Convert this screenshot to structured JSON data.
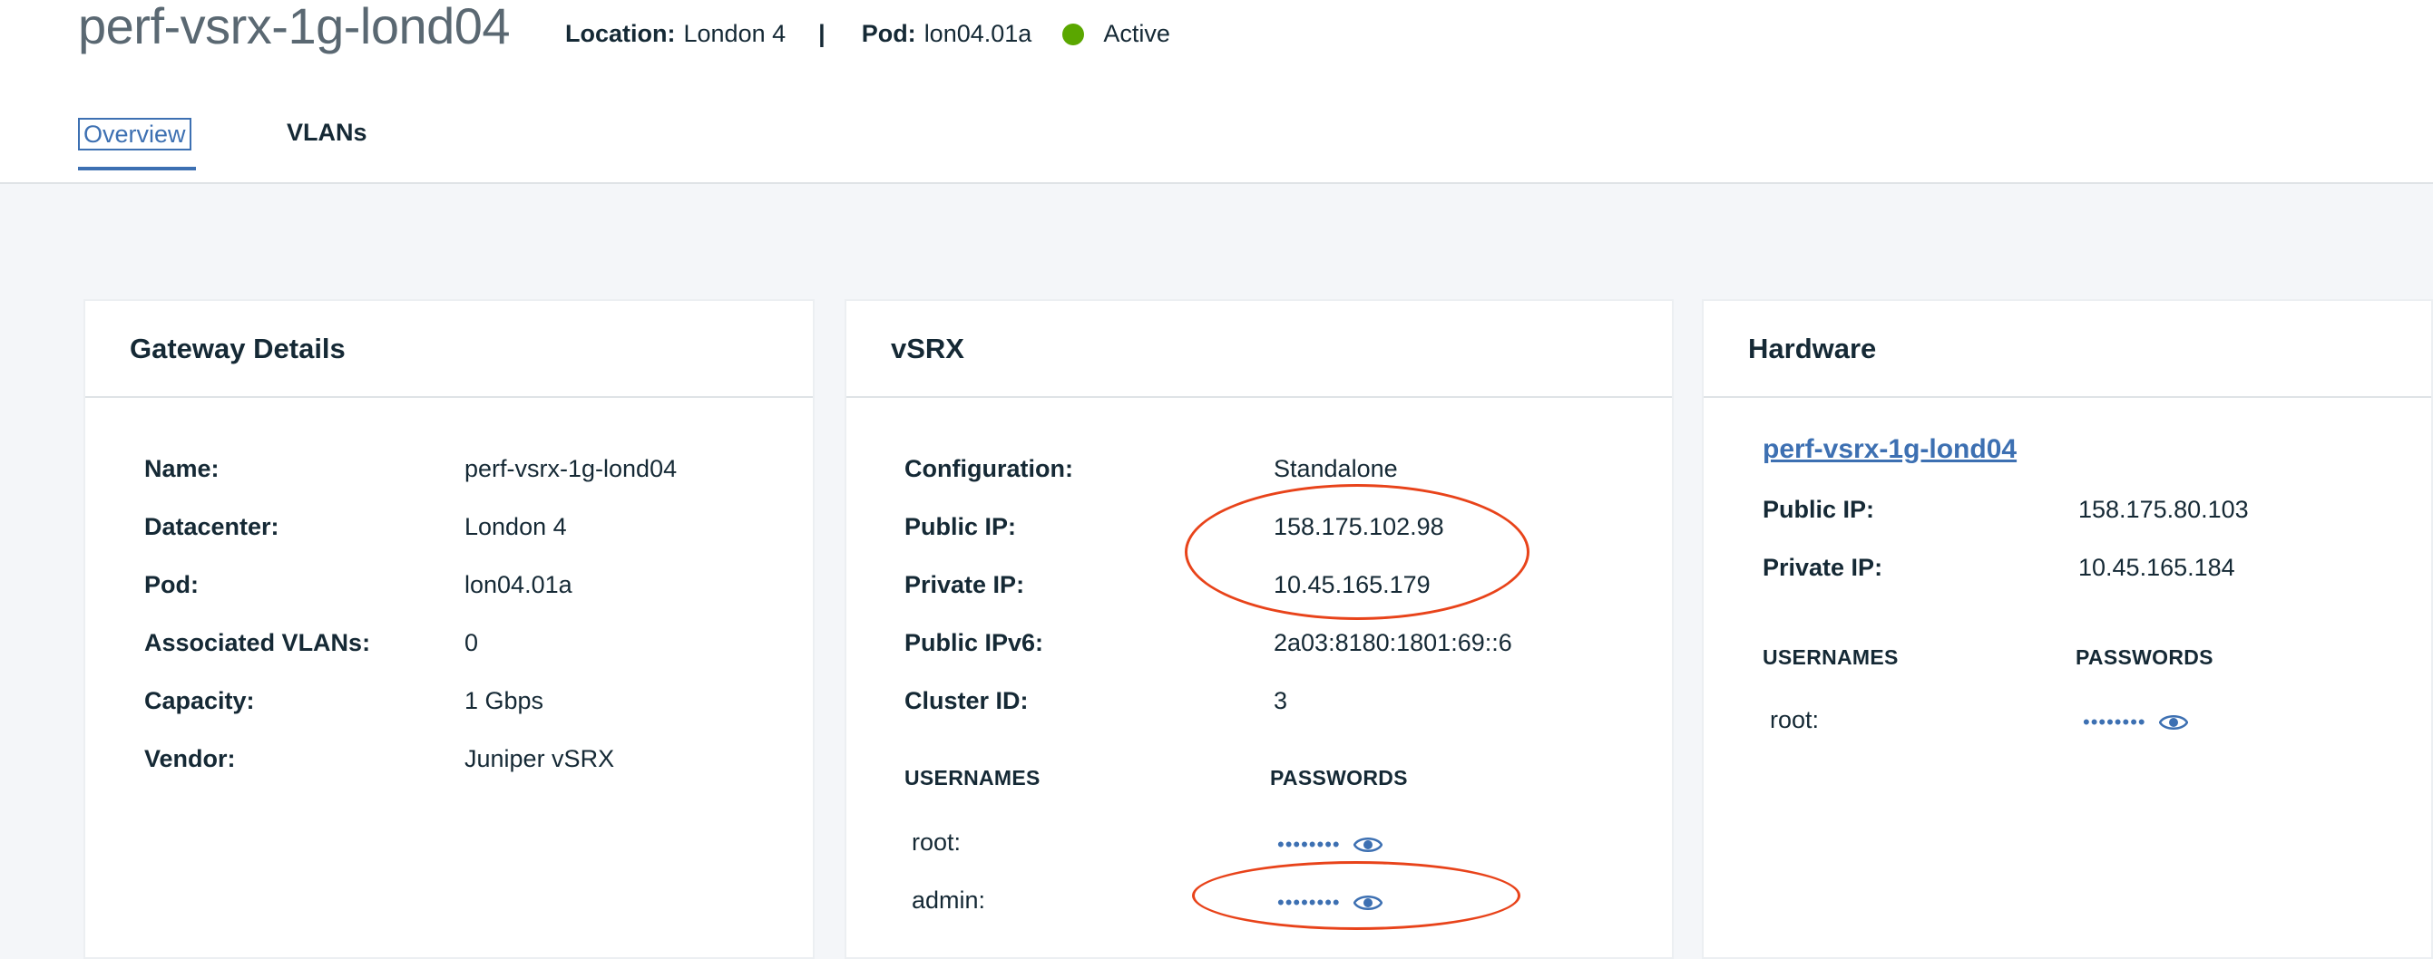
{
  "header": {
    "title": "perf-vsrx-1g-lond04",
    "location_label": "Location:",
    "location_value": "London 4",
    "separator": "|",
    "pod_label": "Pod:",
    "pod_value": "lon04.01a",
    "status": "Active",
    "status_color": "#5aa700"
  },
  "tabs": [
    {
      "label": "Overview",
      "selected": true
    },
    {
      "label": "VLANs",
      "selected": false
    }
  ],
  "gateway_details": {
    "title": "Gateway Details",
    "rows": [
      {
        "label": "Name:",
        "value": "perf-vsrx-1g-lond04"
      },
      {
        "label": "Datacenter:",
        "value": "London 4"
      },
      {
        "label": "Pod:",
        "value": "lon04.01a"
      },
      {
        "label": "Associated VLANs:",
        "value": "0"
      },
      {
        "label": "Capacity:",
        "value": "1 Gbps"
      },
      {
        "label": "Vendor:",
        "value": "Juniper vSRX"
      }
    ]
  },
  "vsrx": {
    "title": "vSRX",
    "rows": [
      {
        "label": "Configuration:",
        "value": "Standalone"
      },
      {
        "label": "Public IP:",
        "value": "158.175.102.98"
      },
      {
        "label": "Private IP:",
        "value": "10.45.165.179"
      },
      {
        "label": "Public IPv6:",
        "value": "2a03:8180:1801:69::6"
      },
      {
        "label": "Cluster ID:",
        "value": "3"
      }
    ],
    "usernames_header": "USERNAMES",
    "passwords_header": "PASSWORDS",
    "credentials": [
      {
        "username": "root:",
        "password_mask": "••••••••"
      },
      {
        "username": "admin:",
        "password_mask": "••••••••"
      }
    ]
  },
  "hardware": {
    "title": "Hardware",
    "link": "perf-vsrx-1g-lond04",
    "rows": [
      {
        "label": "Public IP:",
        "value": "158.175.80.103"
      },
      {
        "label": "Private IP:",
        "value": "10.45.165.184"
      }
    ],
    "usernames_header": "USERNAMES",
    "passwords_header": "PASSWORDS",
    "credentials": [
      {
        "username": "root:",
        "password_mask": "••••••••"
      }
    ]
  },
  "icons": {
    "password_reveal": "eye-icon",
    "status": "status-dot-icon"
  },
  "colors": {
    "accent": "#3d70b2",
    "annotation": "#e8431a",
    "background": "#f4f6f9"
  }
}
